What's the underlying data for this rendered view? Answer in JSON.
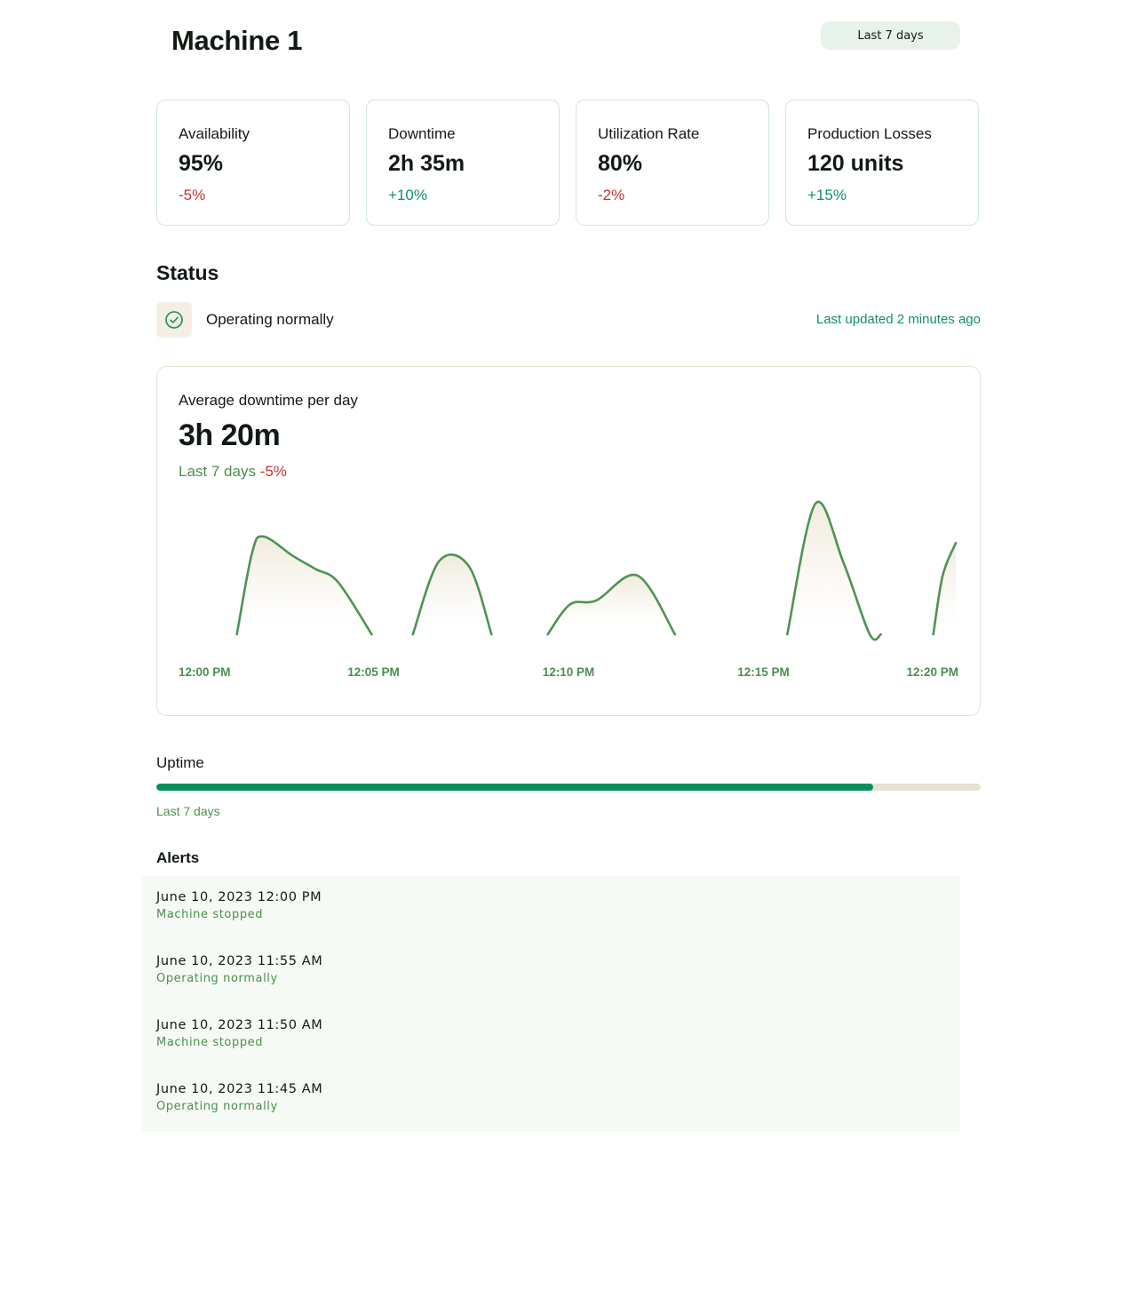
{
  "header": {
    "title": "Machine 1",
    "range_button": "Last 7 days"
  },
  "kpis": [
    {
      "label": "Availability",
      "value": "95%",
      "change": "-5%"
    },
    {
      "label": "Downtime",
      "value": "2h 35m",
      "change": "+10%"
    },
    {
      "label": "Utilization Rate",
      "value": "80%",
      "change": "-2%"
    },
    {
      "label": "Production Losses",
      "value": "120 units",
      "change": "+15%"
    }
  ],
  "status": {
    "heading": "Status",
    "icon": "check-circle-icon",
    "text": "Operating normally",
    "updated": "Last updated 2 minutes ago"
  },
  "downtime_card": {
    "label": "Average downtime per day",
    "value": "3h 20m",
    "period": "Last 7 days",
    "change": "-5%"
  },
  "chart_data": {
    "type": "area",
    "x_ticks": [
      "12:00 PM",
      "12:05 PM",
      "12:10 PM",
      "12:15 PM",
      "12:20 PM"
    ],
    "xlim": [
      0,
      20
    ],
    "ylim": [
      0,
      1
    ],
    "segments": [
      {
        "x": [
          0.8,
          1.2,
          1.5,
          2.3,
          2.9,
          3.5,
          4.4
        ],
        "y": [
          0.0,
          0.62,
          0.75,
          0.6,
          0.5,
          0.4,
          0.0
        ]
      },
      {
        "x": [
          5.5,
          6.2,
          7.0,
          7.6
        ],
        "y": [
          0.0,
          0.56,
          0.52,
          0.0
        ]
      },
      {
        "x": [
          9.1,
          9.7,
          10.4,
          11.5,
          12.5
        ],
        "y": [
          0.0,
          0.23,
          0.26,
          0.45,
          0.0
        ]
      },
      {
        "x": [
          15.5,
          16.25,
          17.0,
          17.7,
          18.0
        ],
        "y": [
          0.0,
          1.0,
          0.55,
          0.0,
          0.0
        ]
      },
      {
        "x": [
          19.4,
          19.65,
          20.0
        ],
        "y": [
          0.0,
          0.45,
          0.7
        ]
      }
    ],
    "grid": false,
    "colors": {
      "line": "#4f9353",
      "fill": "#f4efe4"
    }
  },
  "uptime": {
    "label": "Uptime",
    "value_percent": 87,
    "period": "Last 7 days"
  },
  "alerts": {
    "heading": "Alerts",
    "items": [
      {
        "time": "June 10, 2023 12:00 PM",
        "message": "Machine stopped"
      },
      {
        "time": "June 10, 2023 11:55 AM",
        "message": "Operating normally"
      },
      {
        "time": "June 10, 2023 11:50 AM",
        "message": "Machine stopped"
      },
      {
        "time": "June 10, 2023 11:45 AM",
        "message": "Operating normally"
      }
    ]
  },
  "colors": {
    "accent": "#11935b",
    "negative": "#c0342f",
    "muted_green": "#4c8f4f",
    "progress": "#0c8f5d"
  }
}
